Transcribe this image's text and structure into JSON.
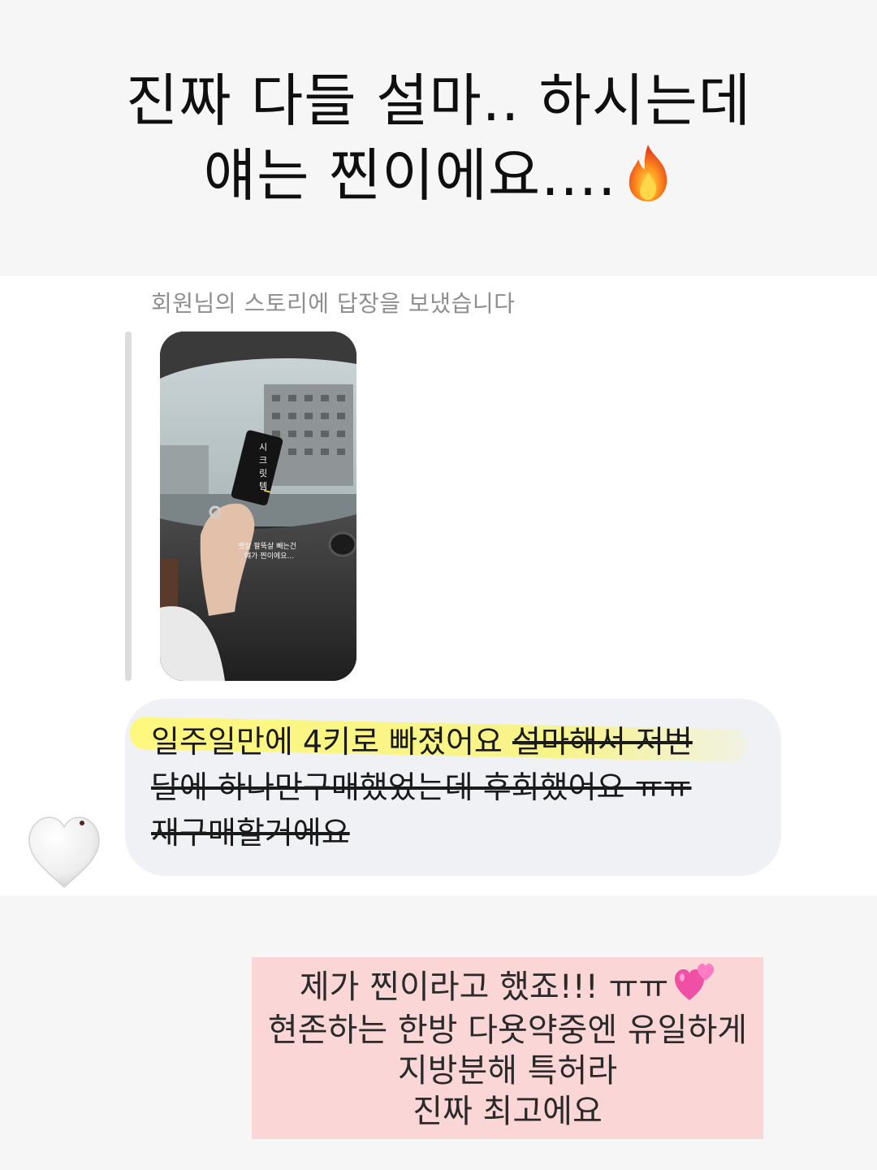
{
  "headline": {
    "line1": "진짜 다들 설마.. 하시는데",
    "line2": "얘는 찐이에요....",
    "emoji_icon": "fire-icon"
  },
  "dm": {
    "story_caption": "회원님의 스토리에 답장을 보냈습니다",
    "story_card": {
      "card_text": [
        "시",
        "크",
        "릿",
        "템"
      ],
      "overlay_line1": "뱃살 팔뚝살 빼는건",
      "overlay_line2": "얘가 찐이에요..."
    },
    "message": {
      "line1_plain": "일주일만에 4키로 빠졌어요 ",
      "line1_struck": "설마해서 저번",
      "line2_struck": "달에 하나만구매했었는데 후회했어요 ㅠㅠ",
      "line3_struck": "재구매할거에요"
    },
    "reaction_icon": "white-heart-icon"
  },
  "reply": {
    "line1": "제가 찐이라고 했죠!!! ㅠㅠ",
    "line2": "현존하는 한방 다욧약중엔 유일하게",
    "line3": "지방분해 특허라",
    "line4": "진짜 최고에요",
    "emoji_icon": "two-hearts-icon"
  },
  "colors": {
    "page_bg": "#f6f6f6",
    "bubble_bg": "#eff1f4",
    "highlight": "#fff878",
    "reply_bg": "#fbd6d6"
  }
}
